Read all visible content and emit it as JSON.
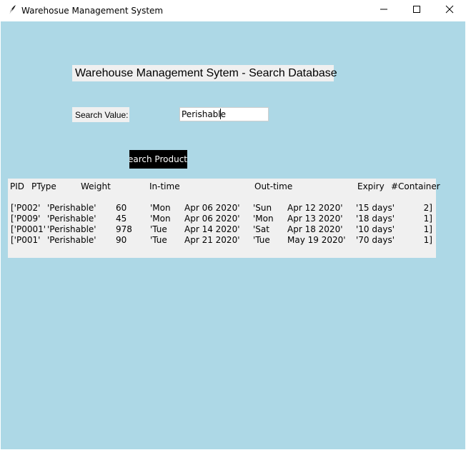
{
  "window": {
    "title": "Warehosue Management System",
    "app_icon": "feather-icon",
    "controls": [
      "minimize-icon",
      "maximize-icon",
      "close-icon"
    ]
  },
  "colors": {
    "background": "#add8e6",
    "panel": "#f0f0f0",
    "button": "#000000"
  },
  "heading": "Warehouse Management Sytem - Search Database",
  "search": {
    "label": "Search Value:",
    "value": "Perishable",
    "button_label": "Search Product"
  },
  "results": {
    "headers": [
      "PID",
      "PType",
      "Weight",
      "In-time",
      "Out-time",
      "Expiry",
      "#Container"
    ],
    "rows": [
      [
        "['P002'",
        "'Perishable'",
        "60",
        "'Mon",
        "Apr 06 2020'",
        "'Sun",
        "Apr 12 2020'",
        "'15 days'",
        "2]"
      ],
      [
        "['P009'",
        "'Perishable'",
        "45",
        "'Mon",
        "Apr 06 2020'",
        "'Mon",
        "Apr 13 2020'",
        "'18 days'",
        "1]"
      ],
      [
        "['P0001'",
        "'Perishable'",
        "978",
        "'Tue",
        "Apr 14 2020'",
        "'Sat",
        "Apr 18 2020'",
        "'10 days'",
        "1]"
      ],
      [
        "['P001'",
        "'Perishable'",
        "90",
        "'Tue",
        "Apr 21 2020'",
        "'Tue",
        "May 19 2020'",
        "'70 days'",
        "1]"
      ]
    ]
  }
}
